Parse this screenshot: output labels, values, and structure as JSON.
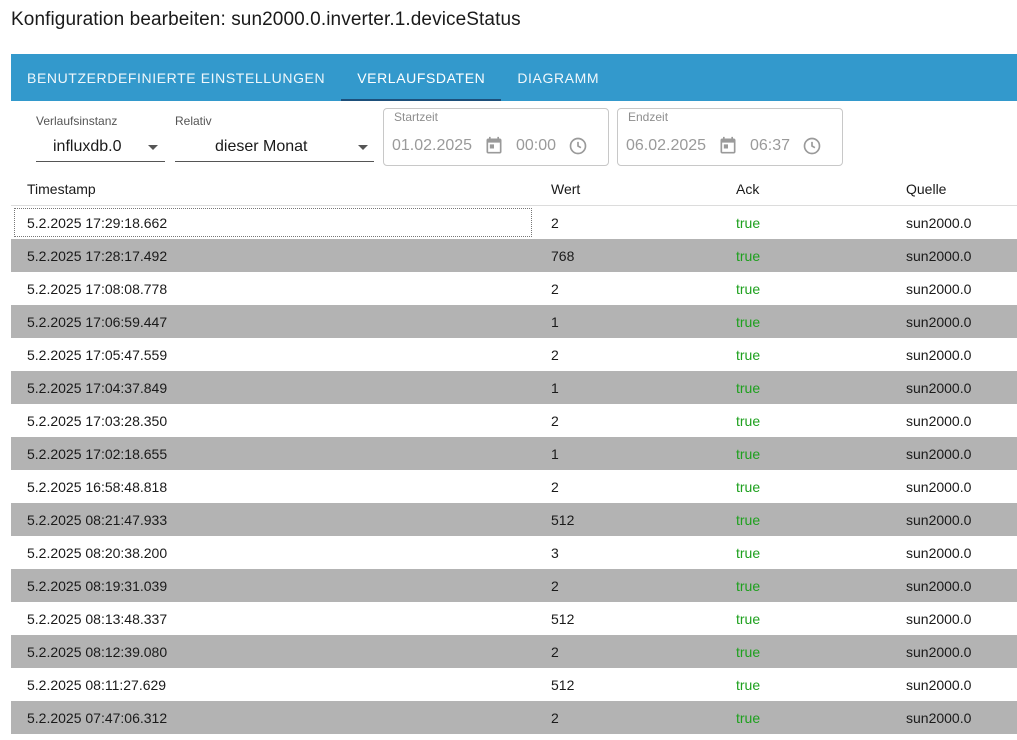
{
  "dialog": {
    "title": "Konfiguration bearbeiten: sun2000.0.inverter.1.deviceStatus"
  },
  "tabs": [
    {
      "label": "BENUTZERDEFINIERTE EINSTELLUNGEN"
    },
    {
      "label": "VERLAUFSDATEN"
    },
    {
      "label": "DIAGRAMM"
    }
  ],
  "filters": {
    "instance": {
      "label": "Verlaufsinstanz",
      "value": "influxdb.0"
    },
    "relative": {
      "label": "Relativ",
      "value": "dieser Monat"
    },
    "start": {
      "label": "Startzeit",
      "date": "01.02.2025",
      "time": "00:00"
    },
    "end": {
      "label": "Endzeit",
      "date": "06.02.2025",
      "time": "06:37"
    }
  },
  "table": {
    "columns": [
      "Timestamp",
      "Wert",
      "Ack",
      "Quelle"
    ],
    "rows": [
      {
        "timestamp": "5.2.2025 17:29:18.662",
        "wert": "2",
        "ack": "true",
        "quelle": "sun2000.0"
      },
      {
        "timestamp": "5.2.2025 17:28:17.492",
        "wert": "768",
        "ack": "true",
        "quelle": "sun2000.0"
      },
      {
        "timestamp": "5.2.2025 17:08:08.778",
        "wert": "2",
        "ack": "true",
        "quelle": "sun2000.0"
      },
      {
        "timestamp": "5.2.2025 17:06:59.447",
        "wert": "1",
        "ack": "true",
        "quelle": "sun2000.0"
      },
      {
        "timestamp": "5.2.2025 17:05:47.559",
        "wert": "2",
        "ack": "true",
        "quelle": "sun2000.0"
      },
      {
        "timestamp": "5.2.2025 17:04:37.849",
        "wert": "1",
        "ack": "true",
        "quelle": "sun2000.0"
      },
      {
        "timestamp": "5.2.2025 17:03:28.350",
        "wert": "2",
        "ack": "true",
        "quelle": "sun2000.0"
      },
      {
        "timestamp": "5.2.2025 17:02:18.655",
        "wert": "1",
        "ack": "true",
        "quelle": "sun2000.0"
      },
      {
        "timestamp": "5.2.2025 16:58:48.818",
        "wert": "2",
        "ack": "true",
        "quelle": "sun2000.0"
      },
      {
        "timestamp": "5.2.2025 08:21:47.933",
        "wert": "512",
        "ack": "true",
        "quelle": "sun2000.0"
      },
      {
        "timestamp": "5.2.2025 08:20:38.200",
        "wert": "3",
        "ack": "true",
        "quelle": "sun2000.0"
      },
      {
        "timestamp": "5.2.2025 08:19:31.039",
        "wert": "2",
        "ack": "true",
        "quelle": "sun2000.0"
      },
      {
        "timestamp": "5.2.2025 08:13:48.337",
        "wert": "512",
        "ack": "true",
        "quelle": "sun2000.0"
      },
      {
        "timestamp": "5.2.2025 08:12:39.080",
        "wert": "2",
        "ack": "true",
        "quelle": "sun2000.0"
      },
      {
        "timestamp": "5.2.2025 08:11:27.629",
        "wert": "512",
        "ack": "true",
        "quelle": "sun2000.0"
      },
      {
        "timestamp": "5.2.2025 07:47:06.312",
        "wert": "2",
        "ack": "true",
        "quelle": "sun2000.0"
      }
    ]
  },
  "colors": {
    "tabbar": "#3399cc",
    "ack_true": "#1ea01e",
    "row_alt": "#b3b3b3"
  }
}
